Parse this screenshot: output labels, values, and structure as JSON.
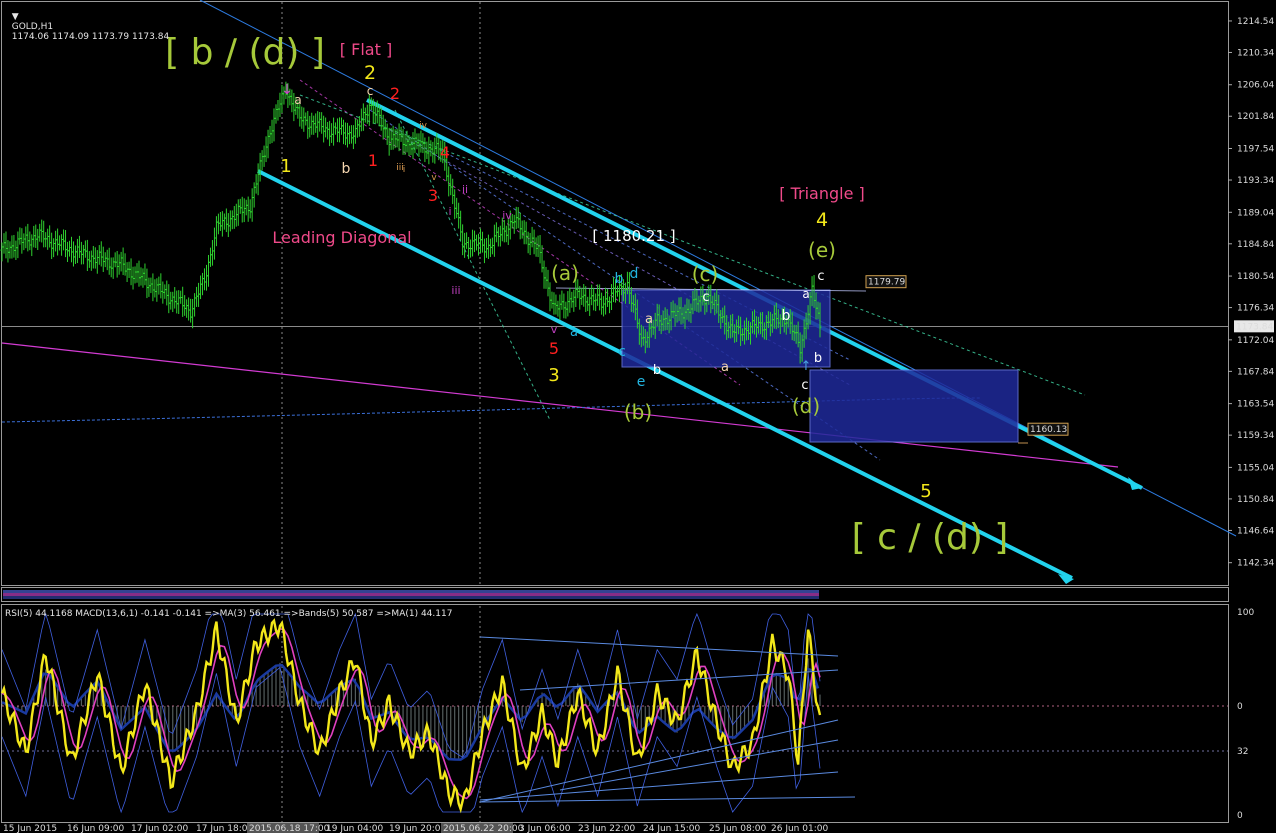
{
  "header": {
    "symbol": "GOLD,H1",
    "ohlc": "1174.06 1174.09 1173.79 1173.84"
  },
  "indicator_header": "RSI(5) 44.1168 MACD(13,6,1) -0.141 -0.141 =>MA(3) 56.461 =>Bands(5) 50.587 =>MA(1) 44.117",
  "colors": {
    "background": "#000000",
    "candle": "#2fd12f",
    "channel": "#22d3ee",
    "magenta": "#d33bd3",
    "box": "#1f2a9a",
    "rsi": "#f3e81a",
    "ma_pink": "#e040c0",
    "bands": "#3f5fe0",
    "histogram": "#2e4a4a",
    "grid": "#7a7a7a"
  },
  "chart_data": [
    {
      "type": "line",
      "name": "price",
      "title": "GOLD,H1",
      "ylim": [
        1139.5,
        1216.0
      ],
      "y_ticks": [
        "1214.54",
        "1210.34",
        "1206.04",
        "1201.84",
        "1197.54",
        "1193.34",
        "1189.04",
        "1184.84",
        "1180.54",
        "1176.34",
        "1172.04",
        "1167.84",
        "1163.54",
        "1159.34",
        "1155.04",
        "1150.84",
        "1146.64",
        "1142.34"
      ],
      "current_price_label": "1173.84",
      "level_labels": [
        {
          "text": "1179.79",
          "value": 1179.79
        },
        {
          "text": "1160.13",
          "value": 1160.13
        }
      ],
      "x_labels": [
        "15 Jun 2015",
        "16 Jun 09:00",
        "17 Jun 02:00",
        "17 Jun 18:00",
        "2015.06.18 17:00",
        "19 Jun 04:00",
        "19 Jun 20:00",
        "2015.06.22 20:00",
        "3 Jun 06:00",
        "23 Jun 22:00",
        "24 Jun 15:00",
        "25 Jun 08:00",
        "26 Jun 01:00"
      ],
      "path_keypoints": [
        {
          "t": 0,
          "v": 1184.0
        },
        {
          "t": 18,
          "v": 1186.0
        },
        {
          "t": 40,
          "v": 1183.5
        },
        {
          "t": 60,
          "v": 1182.0
        },
        {
          "t": 80,
          "v": 1178.5
        },
        {
          "t": 95,
          "v": 1176.0
        },
        {
          "t": 102,
          "v": 1180.0
        },
        {
          "t": 108,
          "v": 1187.0
        },
        {
          "t": 125,
          "v": 1190.0
        },
        {
          "t": 135,
          "v": 1200.0
        },
        {
          "t": 143,
          "v": 1205.5
        },
        {
          "t": 150,
          "v": 1201.5
        },
        {
          "t": 165,
          "v": 1200.0
        },
        {
          "t": 178,
          "v": 1199.5
        },
        {
          "t": 185,
          "v": 1203.5
        },
        {
          "t": 195,
          "v": 1199.0
        },
        {
          "t": 210,
          "v": 1198.0
        },
        {
          "t": 222,
          "v": 1197.0
        },
        {
          "t": 232,
          "v": 1185.0
        },
        {
          "t": 245,
          "v": 1184.5
        },
        {
          "t": 258,
          "v": 1188.0
        },
        {
          "t": 270,
          "v": 1184.0
        },
        {
          "t": 278,
          "v": 1176.0
        },
        {
          "t": 290,
          "v": 1178.0
        },
        {
          "t": 302,
          "v": 1177.0
        },
        {
          "t": 315,
          "v": 1179.5
        },
        {
          "t": 322,
          "v": 1172.0
        },
        {
          "t": 330,
          "v": 1174.5
        },
        {
          "t": 345,
          "v": 1176.0
        },
        {
          "t": 355,
          "v": 1178.0
        },
        {
          "t": 368,
          "v": 1173.0
        },
        {
          "t": 382,
          "v": 1174.0
        },
        {
          "t": 395,
          "v": 1175.0
        },
        {
          "t": 402,
          "v": 1171.0
        },
        {
          "t": 408,
          "v": 1178.5
        },
        {
          "t": 412,
          "v": 1173.8
        }
      ],
      "wave_labels": [
        {
          "text": "[ b / (d) ]",
          "color": "#a6c93a",
          "big": true
        },
        {
          "text": "[ Flat ]",
          "color": "#f04a8a"
        },
        {
          "text": "Leading Diagonal",
          "color": "#f04a8a"
        },
        {
          "text": "[ Triangle ]",
          "color": "#f04a8a"
        },
        {
          "text": "[ 1180.21 ]",
          "color": "#ffffff"
        },
        {
          "text": "[ c / (d) ]",
          "color": "#a6c93a",
          "big": true
        },
        {
          "text": "1",
          "color": "#f3e81a"
        },
        {
          "text": "2",
          "color": "#f3e81a"
        },
        {
          "text": "3",
          "color": "#f3e81a"
        },
        {
          "text": "4",
          "color": "#f3e81a"
        },
        {
          "text": "5",
          "color": "#f3e81a"
        },
        {
          "text": "1",
          "color": "#ff2020"
        },
        {
          "text": "2",
          "color": "#ff2020"
        },
        {
          "text": "3",
          "color": "#ff2020"
        },
        {
          "text": "4",
          "color": "#ff2020"
        },
        {
          "text": "5",
          "color": "#ff2020"
        },
        {
          "text": "a",
          "color": "#f5d6b0"
        },
        {
          "text": "b",
          "color": "#f5d6b0"
        },
        {
          "text": "c",
          "color": "#f5d6b0"
        },
        {
          "text": "(a)",
          "color": "#a6c93a"
        },
        {
          "text": "(b)",
          "color": "#a6c93a"
        },
        {
          "text": "(c)",
          "color": "#a6c93a"
        },
        {
          "text": "(d)",
          "color": "#a6c93a"
        },
        {
          "text": "(e)",
          "color": "#a6c93a"
        },
        {
          "text": "a",
          "color": "#22b5e0"
        },
        {
          "text": "b",
          "color": "#22b5e0"
        },
        {
          "text": "c",
          "color": "#22b5e0"
        },
        {
          "text": "d",
          "color": "#22b5e0"
        },
        {
          "text": "e",
          "color": "#22b5e0"
        },
        {
          "text": "a",
          "color": "#f5d6b0"
        },
        {
          "text": "b",
          "color": "#ffffff"
        },
        {
          "text": "c",
          "color": "#ffffff"
        },
        {
          "text": "a",
          "color": "#f5d6b0"
        },
        {
          "text": "b",
          "color": "#ffffff"
        },
        {
          "text": "c",
          "color": "#ffffff"
        },
        {
          "text": "a",
          "color": "#ffffff"
        },
        {
          "text": "b",
          "color": "#ffffff"
        },
        {
          "text": "c",
          "color": "#ffffff"
        },
        {
          "text": "i",
          "color": "#c040c0"
        },
        {
          "text": "ii",
          "color": "#c040c0"
        },
        {
          "text": "iii",
          "color": "#c040c0"
        },
        {
          "text": "iv",
          "color": "#c040c0"
        },
        {
          "text": "v",
          "color": "#c040c0"
        },
        {
          "text": "iv",
          "color": "#d89a50"
        },
        {
          "text": "v",
          "color": "#d89a50"
        },
        {
          "text": "i",
          "color": "#d89a50"
        },
        {
          "text": "iii",
          "color": "#d89a50"
        }
      ]
    },
    {
      "type": "line",
      "name": "oscillators",
      "title": "RSI(5) 44.1168 MACD(13,6,1) -0.141 -0.141 =>MA(3) 56.461 =>Bands(5) 50.587 =>MA(1) 44.117",
      "ylim": [
        -5,
        105
      ],
      "y_ticks": [
        "100",
        "0",
        "32",
        "0"
      ],
      "rsi_keypoints": [
        {
          "t": 0,
          "v": 60
        },
        {
          "t": 12,
          "v": 30
        },
        {
          "t": 22,
          "v": 80
        },
        {
          "t": 35,
          "v": 25
        },
        {
          "t": 48,
          "v": 70
        },
        {
          "t": 60,
          "v": 20
        },
        {
          "t": 72,
          "v": 65
        },
        {
          "t": 85,
          "v": 15
        },
        {
          "t": 98,
          "v": 50
        },
        {
          "t": 108,
          "v": 92
        },
        {
          "t": 118,
          "v": 45
        },
        {
          "t": 128,
          "v": 85
        },
        {
          "t": 140,
          "v": 95
        },
        {
          "t": 150,
          "v": 55
        },
        {
          "t": 160,
          "v": 30
        },
        {
          "t": 170,
          "v": 60
        },
        {
          "t": 178,
          "v": 78
        },
        {
          "t": 186,
          "v": 35
        },
        {
          "t": 195,
          "v": 55
        },
        {
          "t": 205,
          "v": 30
        },
        {
          "t": 215,
          "v": 40
        },
        {
          "t": 225,
          "v": 10
        },
        {
          "t": 233,
          "v": 5
        },
        {
          "t": 242,
          "v": 40
        },
        {
          "t": 252,
          "v": 65
        },
        {
          "t": 262,
          "v": 20
        },
        {
          "t": 272,
          "v": 50
        },
        {
          "t": 280,
          "v": 25
        },
        {
          "t": 290,
          "v": 60
        },
        {
          "t": 300,
          "v": 30
        },
        {
          "t": 310,
          "v": 70
        },
        {
          "t": 320,
          "v": 25
        },
        {
          "t": 330,
          "v": 60
        },
        {
          "t": 340,
          "v": 45
        },
        {
          "t": 350,
          "v": 80
        },
        {
          "t": 360,
          "v": 45
        },
        {
          "t": 368,
          "v": 22
        },
        {
          "t": 378,
          "v": 35
        },
        {
          "t": 388,
          "v": 85
        },
        {
          "t": 396,
          "v": 70
        },
        {
          "t": 401,
          "v": 25
        },
        {
          "t": 406,
          "v": 92
        },
        {
          "t": 412,
          "v": 44
        }
      ]
    }
  ]
}
